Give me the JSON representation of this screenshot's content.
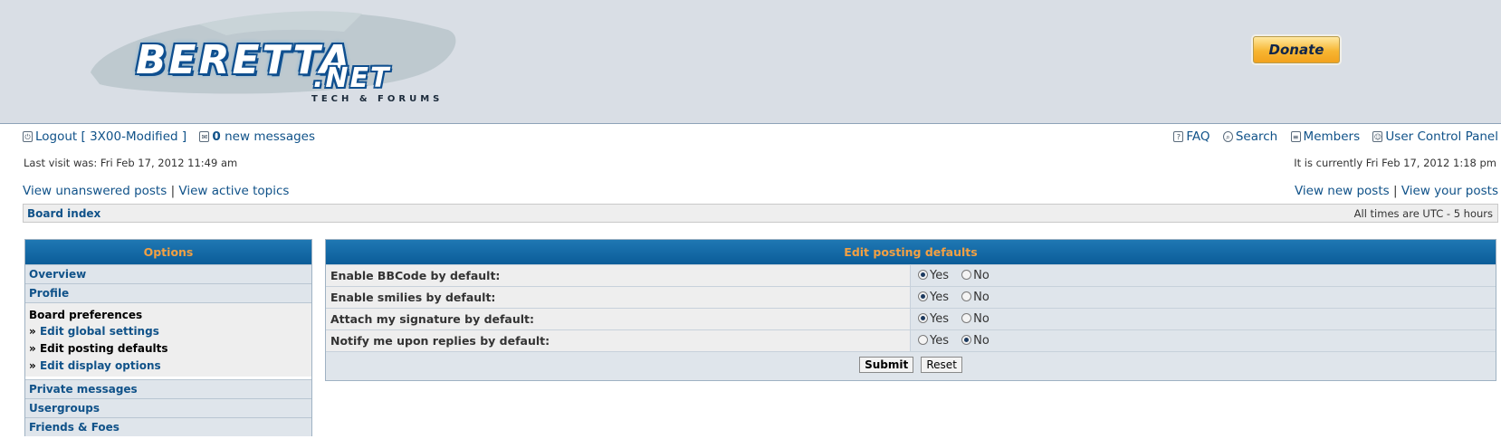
{
  "header": {
    "logo_word": "BERETTA",
    "logo_net": ".NET",
    "logo_sub": "TECH & FORUMS",
    "donate_label": "Donate"
  },
  "userbar": {
    "logout_label": "Logout [ 3X00-Modified ]",
    "messages_count": "0",
    "messages_label": "new messages",
    "faq_label": "FAQ",
    "search_label": "Search",
    "members_label": "Members",
    "ucp_label": "User Control Panel",
    "last_visit": "Last visit was: Fri Feb 17, 2012 11:49 am",
    "current_time": "It is currently Fri Feb 17, 2012 1:18 pm"
  },
  "nav": {
    "unanswered": "View unanswered posts",
    "active": "View active topics",
    "separator": "|",
    "new_posts": "View new posts",
    "your_posts": "View your posts",
    "board_index": "Board index",
    "timezone": "All times are UTC - 5 hours"
  },
  "options_panel": {
    "title": "Options",
    "overview": "Overview",
    "profile": "Profile",
    "board_prefs": "Board preferences",
    "edit_global": "Edit global settings",
    "edit_posting": "Edit posting defaults",
    "edit_display": "Edit display options",
    "private_messages": "Private messages",
    "usergroups": "Usergroups",
    "friends_foes": "Friends & Foes",
    "bullet": "»"
  },
  "form": {
    "title": "Edit posting defaults",
    "yes_label": "Yes",
    "no_label": "No",
    "rows": [
      {
        "label": "Enable BBCode by default:",
        "selected": "yes"
      },
      {
        "label": "Enable smilies by default:",
        "selected": "yes"
      },
      {
        "label": "Attach my signature by default:",
        "selected": "yes"
      },
      {
        "label": "Notify me upon replies by default:",
        "selected": "no"
      }
    ],
    "submit_label": "Submit",
    "reset_label": "Reset"
  }
}
